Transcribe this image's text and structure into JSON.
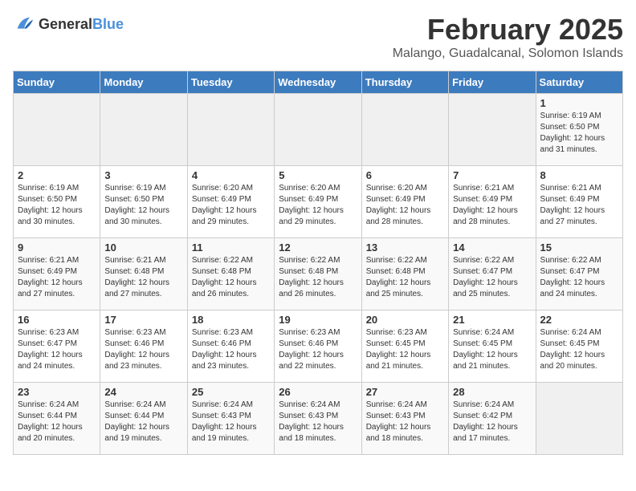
{
  "logo": {
    "general": "General",
    "blue": "Blue"
  },
  "title": "February 2025",
  "subtitle": "Malango, Guadalcanal, Solomon Islands",
  "days_of_week": [
    "Sunday",
    "Monday",
    "Tuesday",
    "Wednesday",
    "Thursday",
    "Friday",
    "Saturday"
  ],
  "weeks": [
    [
      {
        "day": "",
        "info": ""
      },
      {
        "day": "",
        "info": ""
      },
      {
        "day": "",
        "info": ""
      },
      {
        "day": "",
        "info": ""
      },
      {
        "day": "",
        "info": ""
      },
      {
        "day": "",
        "info": ""
      },
      {
        "day": "1",
        "info": "Sunrise: 6:19 AM\nSunset: 6:50 PM\nDaylight: 12 hours\nand 31 minutes."
      }
    ],
    [
      {
        "day": "2",
        "info": "Sunrise: 6:19 AM\nSunset: 6:50 PM\nDaylight: 12 hours\nand 30 minutes."
      },
      {
        "day": "3",
        "info": "Sunrise: 6:19 AM\nSunset: 6:50 PM\nDaylight: 12 hours\nand 30 minutes."
      },
      {
        "day": "4",
        "info": "Sunrise: 6:20 AM\nSunset: 6:49 PM\nDaylight: 12 hours\nand 29 minutes."
      },
      {
        "day": "5",
        "info": "Sunrise: 6:20 AM\nSunset: 6:49 PM\nDaylight: 12 hours\nand 29 minutes."
      },
      {
        "day": "6",
        "info": "Sunrise: 6:20 AM\nSunset: 6:49 PM\nDaylight: 12 hours\nand 28 minutes."
      },
      {
        "day": "7",
        "info": "Sunrise: 6:21 AM\nSunset: 6:49 PM\nDaylight: 12 hours\nand 28 minutes."
      },
      {
        "day": "8",
        "info": "Sunrise: 6:21 AM\nSunset: 6:49 PM\nDaylight: 12 hours\nand 27 minutes."
      }
    ],
    [
      {
        "day": "9",
        "info": "Sunrise: 6:21 AM\nSunset: 6:49 PM\nDaylight: 12 hours\nand 27 minutes."
      },
      {
        "day": "10",
        "info": "Sunrise: 6:21 AM\nSunset: 6:48 PM\nDaylight: 12 hours\nand 27 minutes."
      },
      {
        "day": "11",
        "info": "Sunrise: 6:22 AM\nSunset: 6:48 PM\nDaylight: 12 hours\nand 26 minutes."
      },
      {
        "day": "12",
        "info": "Sunrise: 6:22 AM\nSunset: 6:48 PM\nDaylight: 12 hours\nand 26 minutes."
      },
      {
        "day": "13",
        "info": "Sunrise: 6:22 AM\nSunset: 6:48 PM\nDaylight: 12 hours\nand 25 minutes."
      },
      {
        "day": "14",
        "info": "Sunrise: 6:22 AM\nSunset: 6:47 PM\nDaylight: 12 hours\nand 25 minutes."
      },
      {
        "day": "15",
        "info": "Sunrise: 6:22 AM\nSunset: 6:47 PM\nDaylight: 12 hours\nand 24 minutes."
      }
    ],
    [
      {
        "day": "16",
        "info": "Sunrise: 6:23 AM\nSunset: 6:47 PM\nDaylight: 12 hours\nand 24 minutes."
      },
      {
        "day": "17",
        "info": "Sunrise: 6:23 AM\nSunset: 6:46 PM\nDaylight: 12 hours\nand 23 minutes."
      },
      {
        "day": "18",
        "info": "Sunrise: 6:23 AM\nSunset: 6:46 PM\nDaylight: 12 hours\nand 23 minutes."
      },
      {
        "day": "19",
        "info": "Sunrise: 6:23 AM\nSunset: 6:46 PM\nDaylight: 12 hours\nand 22 minutes."
      },
      {
        "day": "20",
        "info": "Sunrise: 6:23 AM\nSunset: 6:45 PM\nDaylight: 12 hours\nand 21 minutes."
      },
      {
        "day": "21",
        "info": "Sunrise: 6:24 AM\nSunset: 6:45 PM\nDaylight: 12 hours\nand 21 minutes."
      },
      {
        "day": "22",
        "info": "Sunrise: 6:24 AM\nSunset: 6:45 PM\nDaylight: 12 hours\nand 20 minutes."
      }
    ],
    [
      {
        "day": "23",
        "info": "Sunrise: 6:24 AM\nSunset: 6:44 PM\nDaylight: 12 hours\nand 20 minutes."
      },
      {
        "day": "24",
        "info": "Sunrise: 6:24 AM\nSunset: 6:44 PM\nDaylight: 12 hours\nand 19 minutes."
      },
      {
        "day": "25",
        "info": "Sunrise: 6:24 AM\nSunset: 6:43 PM\nDaylight: 12 hours\nand 19 minutes."
      },
      {
        "day": "26",
        "info": "Sunrise: 6:24 AM\nSunset: 6:43 PM\nDaylight: 12 hours\nand 18 minutes."
      },
      {
        "day": "27",
        "info": "Sunrise: 6:24 AM\nSunset: 6:43 PM\nDaylight: 12 hours\nand 18 minutes."
      },
      {
        "day": "28",
        "info": "Sunrise: 6:24 AM\nSunset: 6:42 PM\nDaylight: 12 hours\nand 17 minutes."
      },
      {
        "day": "",
        "info": ""
      }
    ]
  ]
}
